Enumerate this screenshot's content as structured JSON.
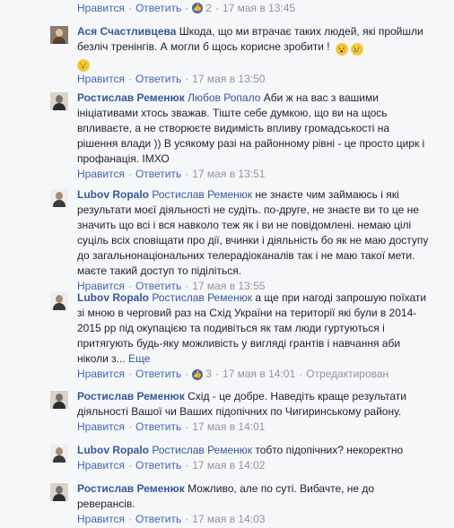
{
  "top": {
    "like": "Нравится",
    "reply": "Ответить",
    "likes": "2",
    "time": "17 мая в 13:45"
  },
  "comments": [
    {
      "author": "Ася Счастливцева",
      "mention": "",
      "text": "Шкода, що ми втрачає таких людей, які пройшли безліч тренінгів. А могли б щось корисне зробити !",
      "emoji": [
        "😵",
        "😢",
        "😟"
      ],
      "like": "Нравится",
      "reply": "Ответить",
      "time": "17 мая в 13:50"
    },
    {
      "author": "Ростислав Ременюк",
      "mention": "Любов Ропало",
      "text": "Аби ж на вас з вашими ініціативами хтось зважав. Тіште себе думкою, що ви на щось впливаєте, а не створюєте видимість впливу громадськості на рішення влади )) В усякому разі на районному рівні - це просто цирк і профанація. ІМХО",
      "like": "Нравится",
      "reply": "Ответить",
      "time": "17 мая в 13:51"
    },
    {
      "author": "Lubov Ropalo",
      "mention": "Ростислав Ременюк",
      "text": "не знаєте чим займаюсь і які результати моєї діяльності не судіть. по-друге, не знаєте ви то це не значить що всі і вся навколо теж як і ви не повідомлені. немаю цілі суціль всіх сповіщати про дії, вчинки і діяльність бо як не маю доступу до загальнонаціональних телерадіоканалів так і не маю такої мети. маєте такий доступ то піділіться.",
      "like": "Нравится",
      "reply": "Ответить",
      "time": "17 мая в 13:55"
    },
    {
      "author": "Lubov Ropalo",
      "mention": "Ростислав Ременюк",
      "text": "а ще при нагоді запрошую поїхати зі мною в черговий раз на Схід України на території які були в 2014-2015 рр під окупацією та подивіться як там люди гуртуються і притягують будь-яку можливість у вигляді грантів і навчання аби ніколи з...",
      "see_more": "Еще",
      "like": "Нравится",
      "reply": "Ответить",
      "likes": "3",
      "time": "17 мая в 14:01",
      "edited": "Отредактирован",
      "menu_icon": "chevron-down-icon"
    },
    {
      "author": "Ростислав Ременюк",
      "mention": "",
      "text": "Схід - це добре. Наведіть краще результати діяльності Вашої чи Ваших підопічних по Чигиринському району.",
      "like": "Нравится",
      "reply": "Ответить",
      "time": "17 мая в 14:01"
    },
    {
      "author": "Lubov Ropalo",
      "mention": "Ростислав Ременюк",
      "text": "тобто підопічних? некоректно",
      "like": "Нравится",
      "reply": "Ответить",
      "time": "17 мая в 14:02"
    },
    {
      "author": "Ростислав Ременюк",
      "mention": "",
      "text": "Можливо, але по суті. Вибачте, не до реверансів.",
      "like": "Нравится",
      "reply": "Ответить",
      "time": "17 мая в 14:03"
    }
  ],
  "colors": {
    "link": "#365899",
    "action": "#4267b2",
    "meta": "#90949c",
    "background": "#f6f7f9"
  }
}
